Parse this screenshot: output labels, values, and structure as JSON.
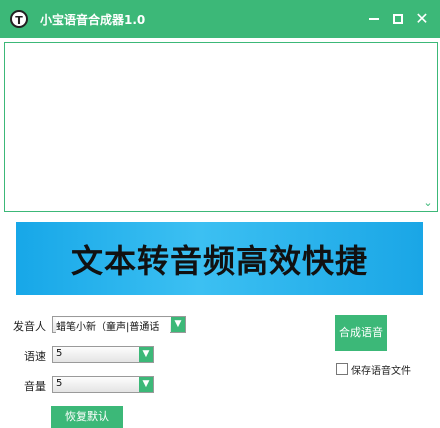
{
  "window": {
    "logo_letter": "T",
    "title": "小宝语音合成器1.0"
  },
  "text_input": {
    "value": ""
  },
  "banner": {
    "text": "文本转音频高效快捷"
  },
  "form": {
    "voice_label": "发音人",
    "voice_value": "蜡笔小新（童声|普通话",
    "speed_label": "语速",
    "speed_value": "5",
    "volume_label": "音量",
    "volume_value": "5"
  },
  "actions": {
    "synthesize_label": "合成语音",
    "save_file_label": "保存语音文件",
    "save_file_checked": false,
    "reset_label": "恢复默认"
  },
  "colors": {
    "accent": "#3cb878",
    "banner": "#1fa9e8"
  }
}
